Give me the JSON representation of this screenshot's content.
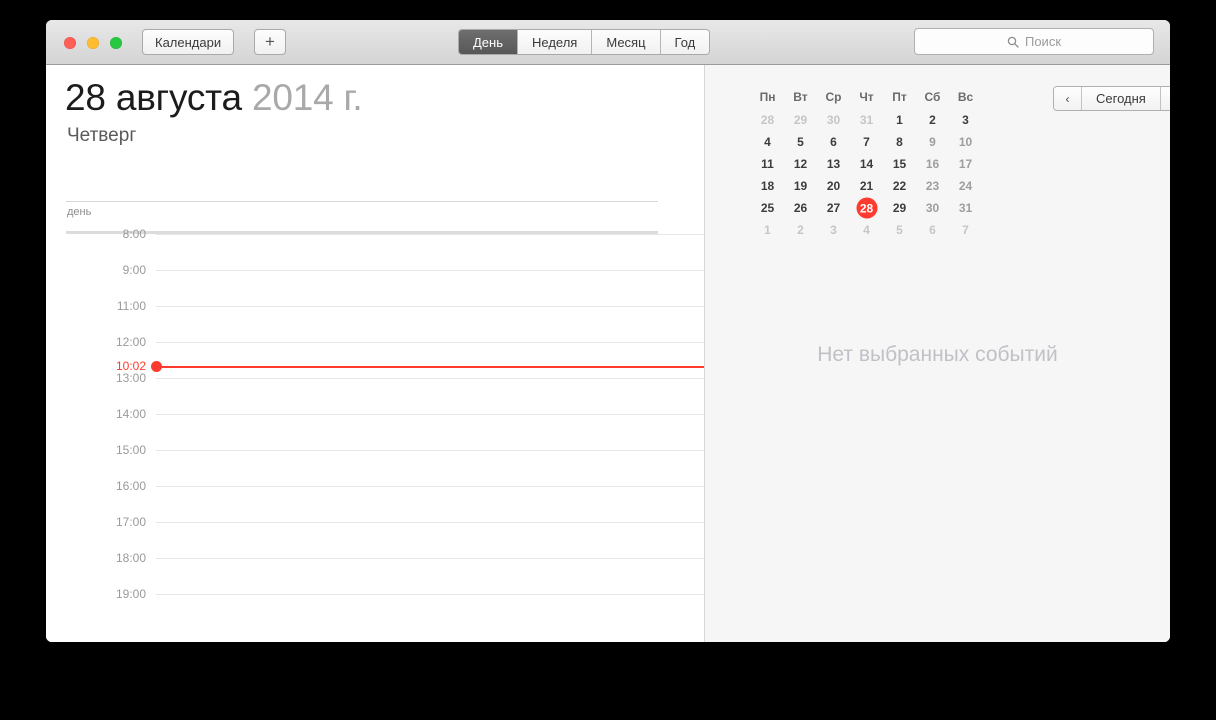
{
  "window": {
    "traffic_lights": [
      "close",
      "minimize",
      "maximize"
    ]
  },
  "toolbar": {
    "calendars_label": "Календари",
    "add_label": "+",
    "views": [
      {
        "label": "День",
        "active": true
      },
      {
        "label": "Неделя",
        "active": false
      },
      {
        "label": "Месяц",
        "active": false
      },
      {
        "label": "Год",
        "active": false
      }
    ],
    "search": {
      "placeholder": "Поиск",
      "value": "",
      "icon": "search-icon"
    }
  },
  "day_view": {
    "date_day_month": "28 августа",
    "date_year": "2014 г.",
    "weekday": "Четверг",
    "allday_label": "день",
    "hours": [
      "8:00",
      "9:00",
      "11:00",
      "12:00",
      "13:00",
      "14:00",
      "15:00",
      "16:00",
      "17:00",
      "18:00",
      "19:00"
    ],
    "current_time": {
      "label": "10:02",
      "color": "#ff3b30"
    }
  },
  "mini_calendar": {
    "weekday_headers": [
      "Пн",
      "Вт",
      "Ср",
      "Чт",
      "Пт",
      "Сб",
      "Вс"
    ],
    "weeks": [
      [
        {
          "day": "28",
          "type": "out"
        },
        {
          "day": "29",
          "type": "out"
        },
        {
          "day": "30",
          "type": "out"
        },
        {
          "day": "31",
          "type": "out"
        },
        {
          "day": "1",
          "type": "wd"
        },
        {
          "day": "2",
          "type": "wd"
        },
        {
          "day": "3",
          "type": "wd"
        }
      ],
      [
        {
          "day": "4",
          "type": "wd"
        },
        {
          "day": "5",
          "type": "wd"
        },
        {
          "day": "6",
          "type": "wd"
        },
        {
          "day": "7",
          "type": "wd"
        },
        {
          "day": "8",
          "type": "wd"
        },
        {
          "day": "9",
          "type": "we"
        },
        {
          "day": "10",
          "type": "we"
        }
      ],
      [
        {
          "day": "11",
          "type": "wd"
        },
        {
          "day": "12",
          "type": "wd"
        },
        {
          "day": "13",
          "type": "wd"
        },
        {
          "day": "14",
          "type": "wd"
        },
        {
          "day": "15",
          "type": "wd"
        },
        {
          "day": "16",
          "type": "we"
        },
        {
          "day": "17",
          "type": "we"
        }
      ],
      [
        {
          "day": "18",
          "type": "wd"
        },
        {
          "day": "19",
          "type": "wd"
        },
        {
          "day": "20",
          "type": "wd"
        },
        {
          "day": "21",
          "type": "wd"
        },
        {
          "day": "22",
          "type": "wd"
        },
        {
          "day": "23",
          "type": "we"
        },
        {
          "day": "24",
          "type": "we"
        }
      ],
      [
        {
          "day": "25",
          "type": "wd"
        },
        {
          "day": "26",
          "type": "wd"
        },
        {
          "day": "27",
          "type": "wd"
        },
        {
          "day": "28",
          "type": "today"
        },
        {
          "day": "29",
          "type": "wd"
        },
        {
          "day": "30",
          "type": "we"
        },
        {
          "day": "31",
          "type": "we"
        }
      ],
      [
        {
          "day": "1",
          "type": "out"
        },
        {
          "day": "2",
          "type": "out"
        },
        {
          "day": "3",
          "type": "out"
        },
        {
          "day": "4",
          "type": "out"
        },
        {
          "day": "5",
          "type": "out"
        },
        {
          "day": "6",
          "type": "out"
        },
        {
          "day": "7",
          "type": "out"
        }
      ]
    ],
    "today_highlight_color": "#ff3b30"
  },
  "navigation": {
    "prev_label": "‹",
    "today_label": "Сегодня",
    "next_label": "›"
  },
  "inspector": {
    "empty_message": "Нет выбранных событий"
  }
}
